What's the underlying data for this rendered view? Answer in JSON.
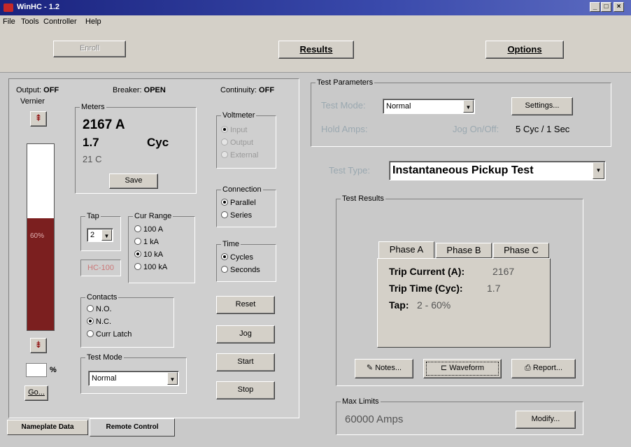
{
  "window": {
    "title": "WinHC - 1.2"
  },
  "menu": [
    "File",
    "Tools",
    "Controller",
    "Help"
  ],
  "toolbar": {
    "enroll": "Enroll",
    "results": "Results",
    "options": "Options"
  },
  "left": {
    "output_label": "Output:",
    "output_value": "OFF",
    "breaker_label": "Breaker:",
    "breaker_value": "OPEN",
    "continuity_label": "Continuity:",
    "continuity_value": "OFF",
    "vernier_label": "Vernier",
    "vernier_percent": "60%",
    "vernier_level": 0.6,
    "percent_input": "",
    "percent_sign": "%",
    "go": "Go...",
    "meters": {
      "title": "Meters",
      "amps": "2167 A",
      "cycles_value": "1.7",
      "cycles_unit": "Cyc",
      "temp": "21 C",
      "save": "Save"
    },
    "voltmeter": {
      "title": "Voltmeter",
      "options": [
        "Input",
        "Output",
        "External"
      ]
    },
    "connection": {
      "title": "Connection",
      "options": [
        "Parallel",
        "Series"
      ],
      "selected": 0
    },
    "tap": {
      "title": "Tap",
      "value": "2"
    },
    "model": "HC-100",
    "cur_range": {
      "title": "Cur Range",
      "options": [
        "100 A",
        "1 kA",
        "10 kA",
        "100 kA"
      ],
      "selected": 2
    },
    "time": {
      "title": "Time",
      "options": [
        "Cycles",
        "Seconds"
      ],
      "selected": 0
    },
    "contacts": {
      "title": "Contacts",
      "options": [
        "N.O.",
        "N.C.",
        "Curr Latch"
      ],
      "selected": 1
    },
    "test_mode": {
      "title": "Test Mode",
      "value": "Normal"
    },
    "buttons": {
      "reset": "Reset",
      "jog": "Jog",
      "start": "Start",
      "stop": "Stop"
    },
    "tabs": [
      "Nameplate Data",
      "Remote Control"
    ]
  },
  "right": {
    "params": {
      "title": "Test Parameters",
      "mode_label": "Test Mode:",
      "mode_value": "Normal",
      "settings": "Settings...",
      "hold_amps": "Hold Amps:",
      "jog_label": "Jog On/Off:",
      "jog_value": "5 Cyc / 1 Sec"
    },
    "test_type_label": "Test Type:",
    "test_type_value": "Instantaneous Pickup Test",
    "results": {
      "title": "Test Results",
      "tabs": [
        "Phase A",
        "Phase B",
        "Phase C"
      ],
      "trip_current_label": "Trip Current (A):",
      "trip_current_value": "2167",
      "trip_time_label": "Trip Time (Cyc):",
      "trip_time_value": "1.7",
      "tap_label": "Tap:",
      "tap_value": "2 - 60%",
      "notes": "Notes...",
      "waveform": "Waveform",
      "report": "Report..."
    },
    "max_limits": {
      "title": "Max Limits",
      "value": "60000 Amps",
      "modify": "Modify..."
    }
  },
  "colors": {
    "title_bar": "#1a237e",
    "vernier_fill": "#7b1f1f",
    "dim_label": "#9aa8b0"
  }
}
